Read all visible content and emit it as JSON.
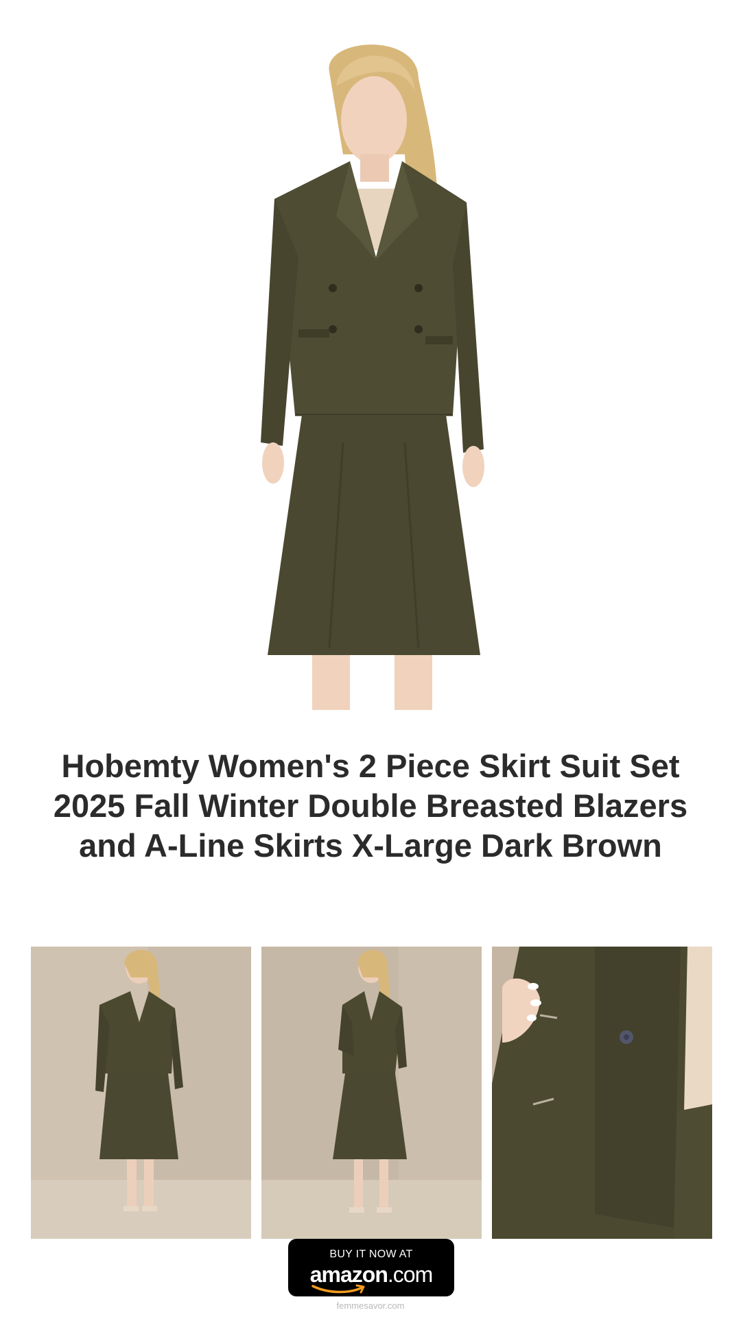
{
  "product": {
    "title": "Hobemty Women's 2 Piece Skirt Suit Set 2025 Fall Winter Double Breasted Blazers and A-Line Skirts X-Large Dark Brown",
    "main_image_icon": "woman-in-olive-skirt-suit-image",
    "thumbnails": [
      {
        "icon": "full-length-front-view-image"
      },
      {
        "icon": "full-length-three-quarter-view-image"
      },
      {
        "icon": "blazer-detail-closeup-image"
      }
    ]
  },
  "buy_button": {
    "top_text": "BUY IT NOW AT",
    "logo_main": "amazon",
    "logo_tld": ".com",
    "logo_icon": "amazon-smile-icon"
  },
  "footer": {
    "site": "femmesavor.com"
  },
  "colors": {
    "suit_olive": "#4b4a30",
    "background": "#ffffff",
    "title_text": "#2b2b2b",
    "button_bg": "#000000",
    "amazon_orange": "#f29c1f"
  }
}
